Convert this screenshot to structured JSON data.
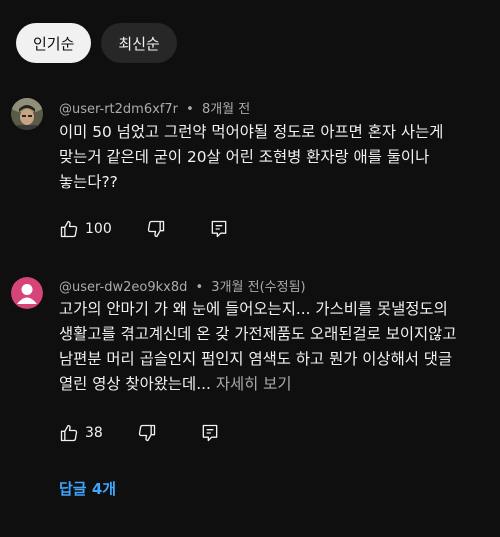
{
  "sort_chips": [
    {
      "label": "인기순",
      "active": true
    },
    {
      "label": "최신순",
      "active": false
    }
  ],
  "comments": [
    {
      "author": "@user-rt2dm6xf7r",
      "separator": "•",
      "time": "8개월 전",
      "text": "이미 50 넘었고 그런약 먹어야될 정도로 아프면 혼자 사는게 맞는거 같은데 굳이 20살 어린 조현병 환자랑 애를 둘이나 놓는다??",
      "likes": "100",
      "avatar_icon": "photo-avatar-icon"
    },
    {
      "author": "@user-dw2eo9kx8d",
      "separator": "•",
      "time": "3개월 전(수정됨)",
      "text": "고가의 안마기 가 왜 눈에 들어오는지... 가스비를 못낼정도의 생활고를 겪고계신데  온 갖 가전제품도 오래된걸로 보이지않고  남편분 머리 곱슬인지 펌인지 염색도 하고  뭔가 이상해서  댓글 열린 영상 찾아왔는데...",
      "more_label": "자세히 보기",
      "likes": "38",
      "avatar_icon": "default-person-avatar-icon",
      "avatar_color": "#d6457a"
    }
  ],
  "replies_label": "답글 4개",
  "colors": {
    "background": "#0f0f0f",
    "link": "#3ea6ff",
    "secondary_text": "#aaaaaa"
  }
}
